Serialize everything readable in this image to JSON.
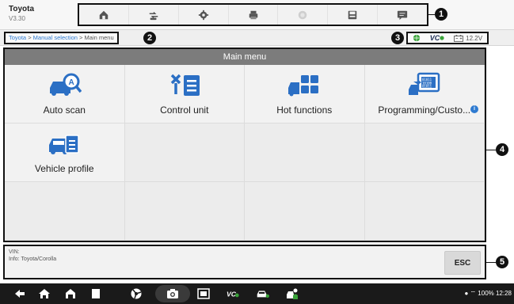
{
  "header": {
    "title": "Toyota",
    "version": "V3.30",
    "toolbar_icons": [
      "home-icon",
      "vehicle-swap-icon",
      "settings-icon",
      "print-icon",
      "help-icon",
      "save-icon",
      "data-logging-icon"
    ]
  },
  "callouts": [
    "1",
    "2",
    "3",
    "4",
    "5"
  ],
  "breadcrumb": {
    "link1": "Toyota",
    "sep1": " > ",
    "link2": "Manual selection",
    "sep2": " > ",
    "current": "Main menu"
  },
  "status": {
    "vci": "VC",
    "voltage": "12.2V"
  },
  "main_menu": {
    "title": "Main menu",
    "items": [
      {
        "label": "Auto scan",
        "icon": "car-search-icon"
      },
      {
        "label": "Control unit",
        "icon": "control-unit-icon"
      },
      {
        "label": "Hot functions",
        "icon": "hot-functions-icon"
      },
      {
        "label": "Programming/Custo...",
        "icon": "programming-icon",
        "info": "i"
      },
      {
        "label": "Vehicle profile",
        "icon": "vehicle-profile-icon"
      }
    ]
  },
  "infobar": {
    "vin": "VIN:",
    "info": "Info: Toyota/Corolla",
    "esc": "ESC"
  },
  "navbar": {
    "status_text": "100%  12:28"
  },
  "colors": {
    "accent_blue": "#2f7bd1",
    "menu_header": "#7c7c7c",
    "icon_blue": "#2b6fc4",
    "nav_bg": "#1a1a1a",
    "vci_green": "#3aa33a"
  }
}
